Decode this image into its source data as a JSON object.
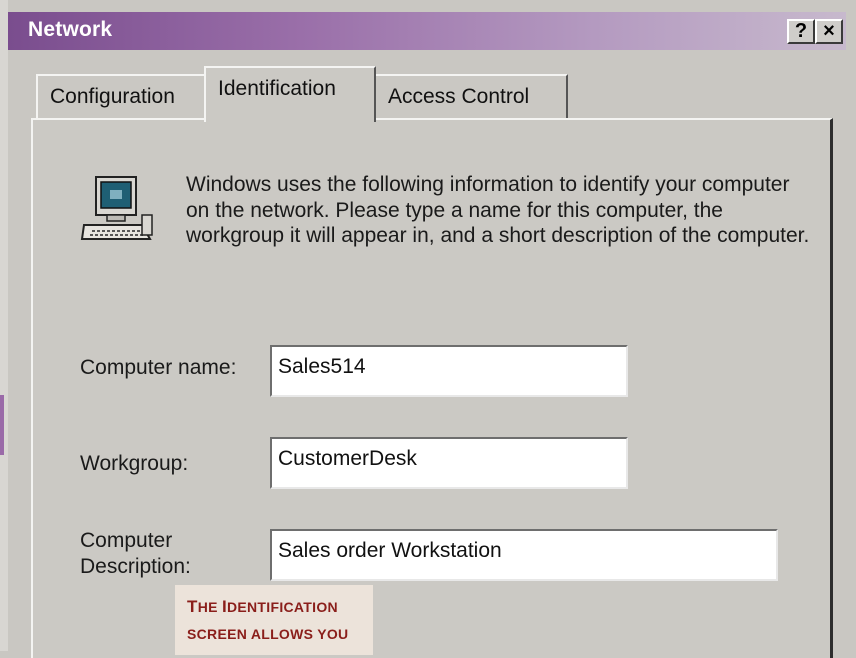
{
  "window": {
    "title": "Network",
    "help_button": "?",
    "close_button": "×"
  },
  "tabs": [
    {
      "label": "Configuration",
      "active": false
    },
    {
      "label": "Identification",
      "active": true
    },
    {
      "label": "Access Control",
      "active": false
    }
  ],
  "identification": {
    "icon": "computer-icon",
    "info_text": "Windows uses the following information to identify your computer on the network.  Please type a name for this computer, the workgroup it will appear in, and a short description of the computer.",
    "computer_name": {
      "label": "Computer name:",
      "value": "Sales514"
    },
    "workgroup": {
      "label": "Workgroup:",
      "value": "CustomerDesk"
    },
    "description": {
      "label_line1": "Computer",
      "label_line2": "Description:",
      "value": "Sales order Workstation"
    }
  },
  "caption": {
    "line1_prefix": "T",
    "line1_rest": "HE ",
    "line1_cap": "I",
    "line1_tail": "DENTIFICATION",
    "line2": "SCREEN ALLOWS YOU"
  },
  "colors": {
    "title_gradient_start": "#7a4d8e",
    "title_gradient_end": "#c7b9cd",
    "dialog_face": "#cbc9c4",
    "caption_text": "#8a1e1a",
    "caption_bg": "#ece3da"
  }
}
